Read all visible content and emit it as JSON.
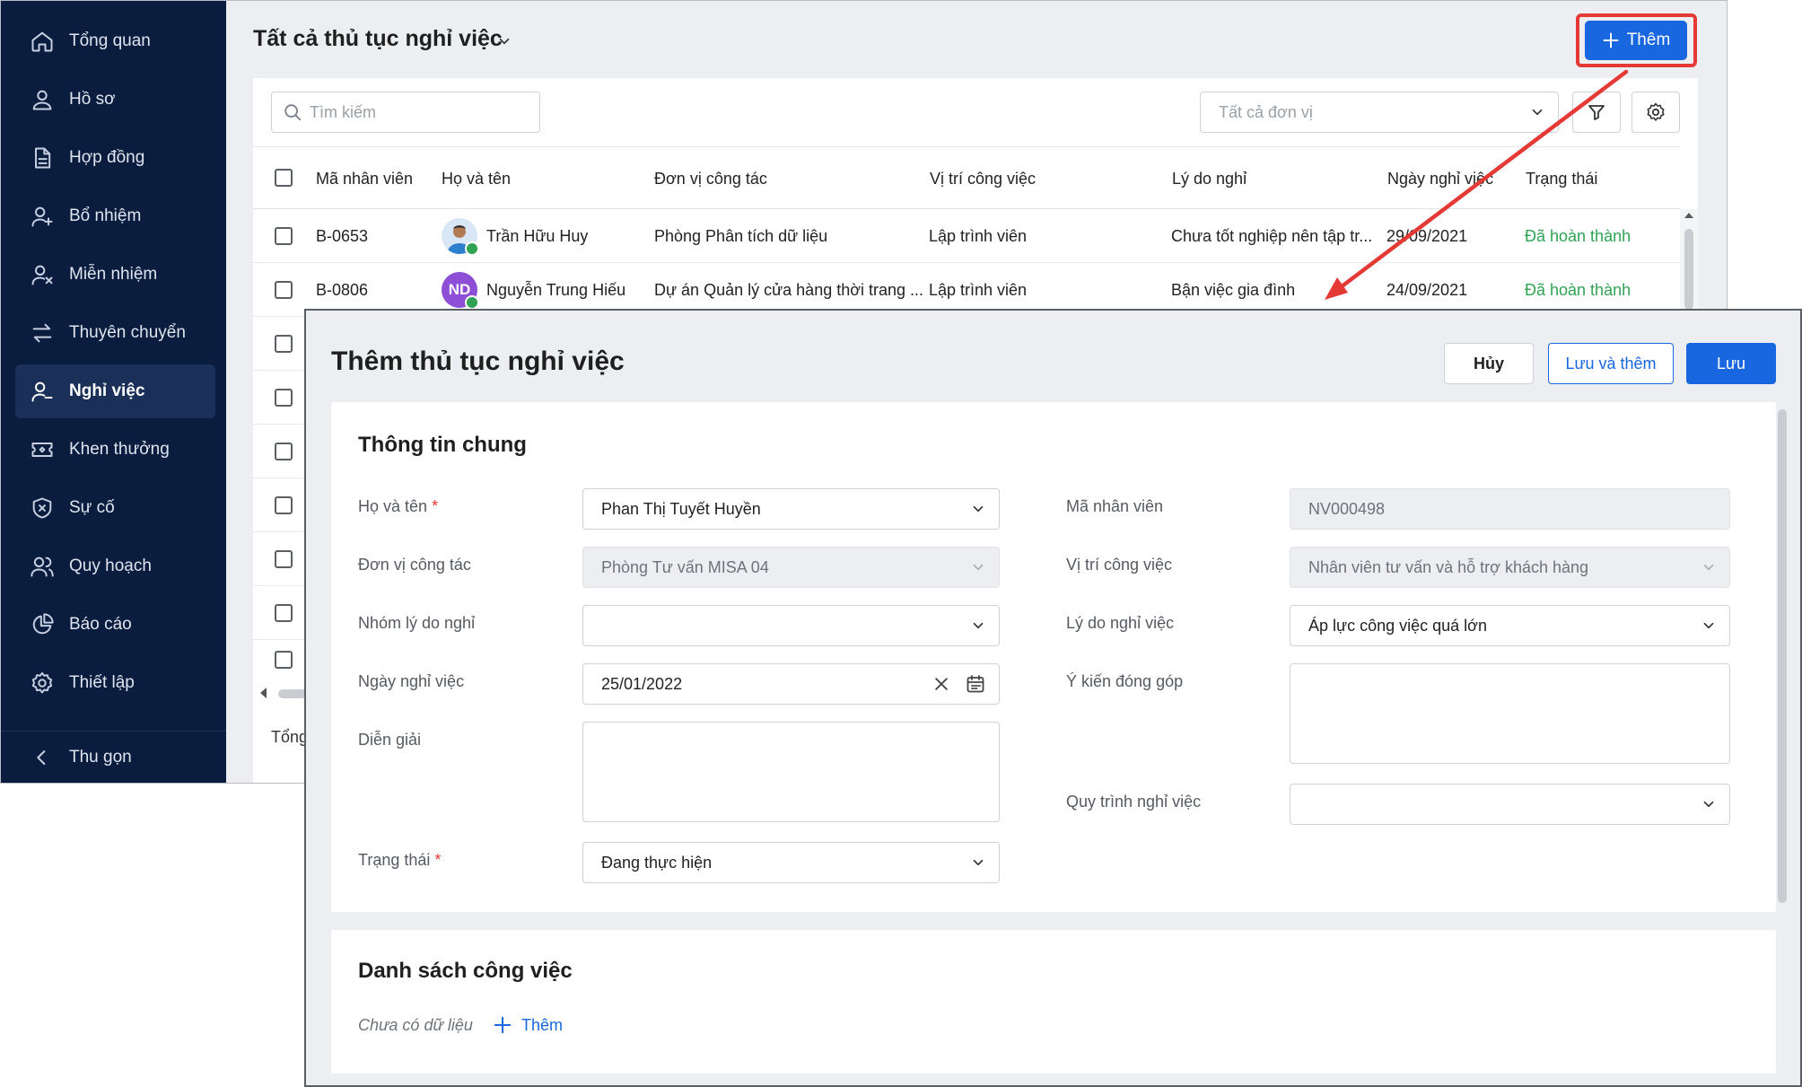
{
  "sidebar": {
    "items": [
      {
        "label": "Tổng quan",
        "icon": "home-icon"
      },
      {
        "label": "Hồ sơ",
        "icon": "user-icon"
      },
      {
        "label": "Hợp đồng",
        "icon": "document-icon"
      },
      {
        "label": "Bổ nhiệm",
        "icon": "user-plus-icon"
      },
      {
        "label": "Miễn nhiệm",
        "icon": "user-remove-icon"
      },
      {
        "label": "Thuyên chuyển",
        "icon": "transfer-icon"
      },
      {
        "label": "Nghỉ việc",
        "icon": "user-leave-icon",
        "active": true
      },
      {
        "label": "Khen thưởng",
        "icon": "ticket-icon"
      },
      {
        "label": "Sự cố",
        "icon": "shield-alert-icon"
      },
      {
        "label": "Quy hoạch",
        "icon": "users-icon"
      },
      {
        "label": "Báo cáo",
        "icon": "pie-chart-icon"
      },
      {
        "label": "Thiết lập",
        "icon": "gear-icon"
      }
    ],
    "collapse_label": "Thu gọn"
  },
  "header": {
    "title": "Tất cả thủ tục nghỉ việc",
    "add_button": "Thêm"
  },
  "toolbar": {
    "search_placeholder": "Tìm kiếm",
    "unit_filter": "Tất cả đơn vị"
  },
  "table": {
    "columns": [
      "Mã nhân viên",
      "Họ và tên",
      "Đơn vị công tác",
      "Vị trí công việc",
      "Lý do nghỉ",
      "Ngày nghỉ việc",
      "Trạng thái"
    ],
    "rows": [
      {
        "id": "B-0653",
        "name": "Trần Hữu Huy",
        "avatar": "photo",
        "unit": "Phòng Phân tích dữ liệu",
        "position": "Lập trình viên",
        "reason": "Chưa tốt nghiệp nên tập tr...",
        "date": "29/09/2021",
        "status": "Đã hoàn thành"
      },
      {
        "id": "B-0806",
        "name": "Nguyễn Trung Hiếu",
        "avatar": "ND",
        "unit": "Dự án Quản lý cửa hàng thời trang ...",
        "position": "Lập trình viên",
        "reason": "Bận việc gia đình",
        "date": "24/09/2021",
        "status": "Đã hoàn thành"
      }
    ],
    "footer_total": "Tổng"
  },
  "colors": {
    "sidebar_bg": "#0b1d3f",
    "primary": "#1867e0",
    "highlight": "#e53935",
    "status_done": "#2fa353"
  },
  "dialog": {
    "title": "Thêm thủ tục nghỉ việc",
    "cancel": "Hủy",
    "save_and_add": "Lưu và thêm",
    "save": "Lưu",
    "general": {
      "title": "Thông tin chung",
      "full_name_label": "Họ và tên",
      "full_name_value": "Phan Thị Tuyết Huyền",
      "employee_code_label": "Mã nhân viên",
      "employee_code_value": "NV000498",
      "unit_label": "Đơn vị công tác",
      "unit_value": "Phòng Tư vấn MISA 04",
      "position_label": "Vị trí công việc",
      "position_value": "Nhân viên tư vấn và hỗ trợ khách hàng",
      "reason_group_label": "Nhóm lý do nghỉ",
      "reason_group_value": "",
      "reason_label": "Lý do nghỉ việc",
      "reason_value": "Áp lực công việc quá lớn",
      "date_label": "Ngày nghỉ việc",
      "date_value": "25/01/2022",
      "feedback_label": "Ý kiến đóng góp",
      "description_label": "Diễn giải",
      "process_label": "Quy trình nghỉ việc",
      "process_value": "",
      "status_label": "Trạng thái",
      "status_value": "Đang thực hiện",
      "required_mark": "*"
    },
    "tasks": {
      "title": "Danh sách công việc",
      "empty": "Chưa có dữ liệu",
      "add": "Thêm"
    }
  }
}
